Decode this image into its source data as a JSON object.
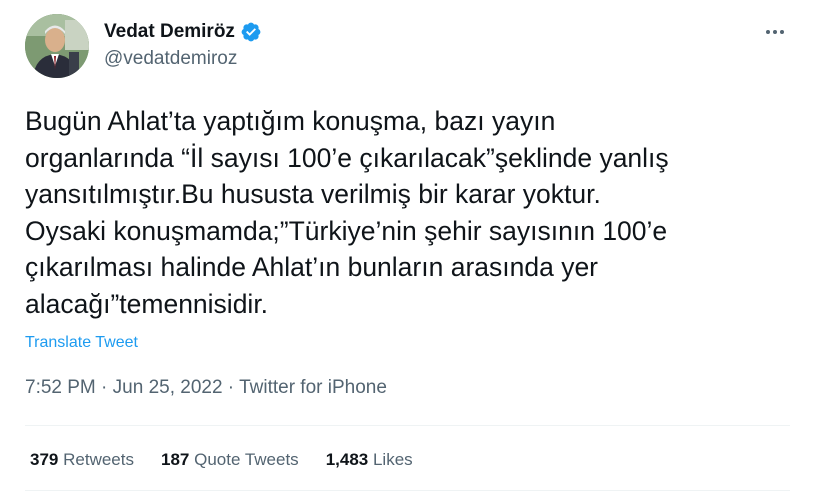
{
  "author": {
    "name": "Vedat Demiröz",
    "handle": "@vedatdemiroz",
    "verified": true
  },
  "tweet": {
    "text": "Bugün Ahlat’ta yaptığım konuşma, bazı yayın\norganlarında “İl sayısı 100’e çıkarılacak”şeklinde yanlış\nyansıtılmıştır.Bu hususta verilmiş bir karar yoktur.\nOysaki konuşmamda;”Türkiye’nin şehir sayısının 100’e\nçıkarılması halinde Ahlat’ın bunların arasında yer\nalacağı”temennisidir.",
    "translate_label": "Translate Tweet",
    "time": "7:52 PM",
    "separator": " · ",
    "date": "Jun 25, 2022",
    "source": "Twitter for iPhone"
  },
  "stats": {
    "retweets_count": "379",
    "retweets_label": "Retweets",
    "quotes_count": "187",
    "quotes_label": "Quote Tweets",
    "likes_count": "1,483",
    "likes_label": "Likes"
  },
  "colors": {
    "verified_badge": "#1d9bf0",
    "link": "#1d9bf0",
    "secondary_text": "#536471",
    "divider": "#eff3f4"
  },
  "icons": {
    "verified": "verified-badge-icon",
    "more": "more-horizontal-icon"
  }
}
